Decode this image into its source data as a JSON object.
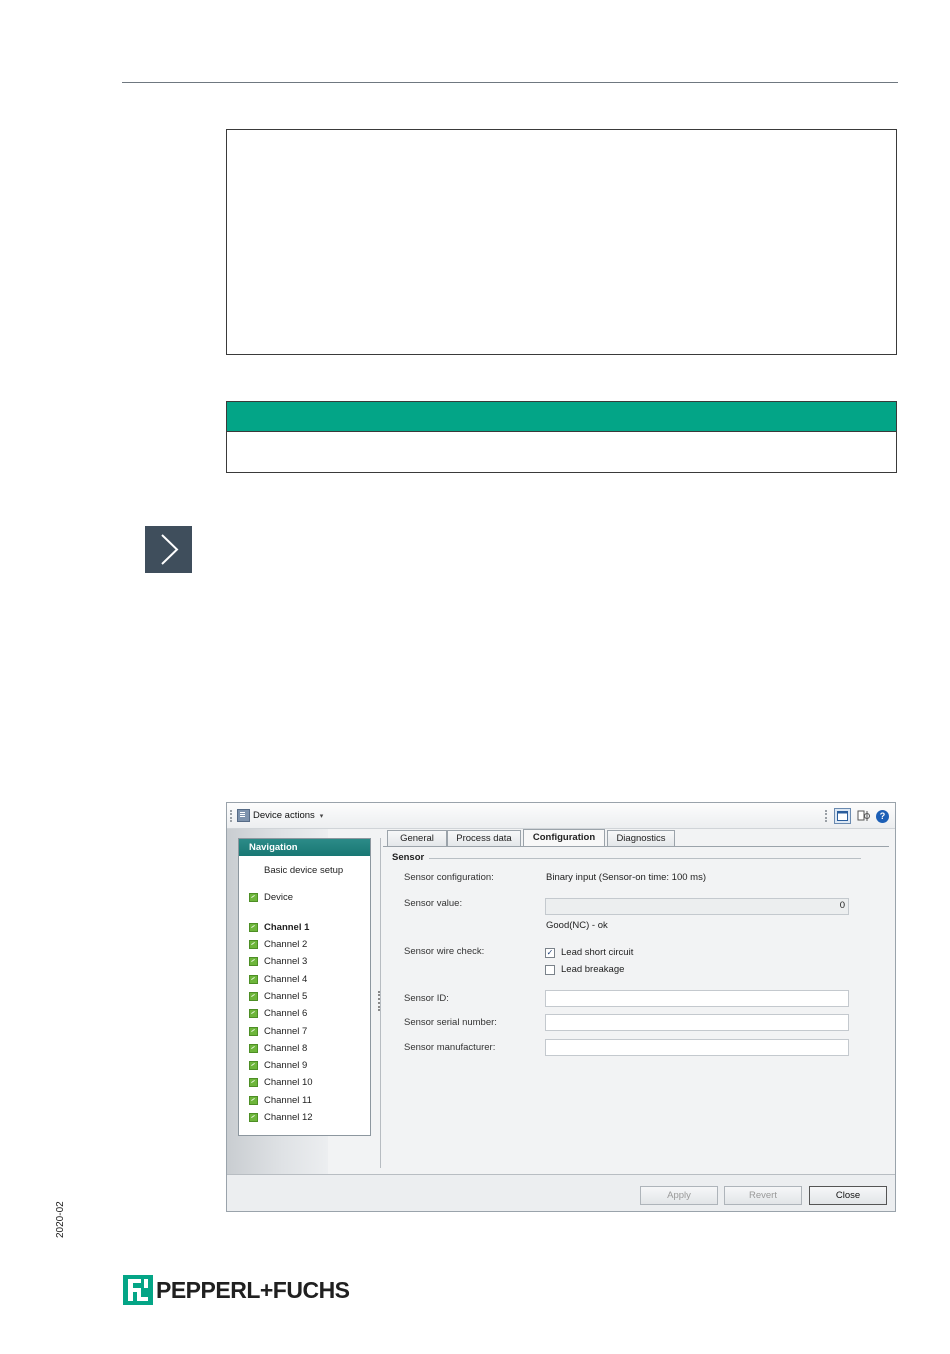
{
  "window": {
    "toolbar": {
      "device_actions_label": "Device actions",
      "caret": "▾"
    },
    "navigation": {
      "title": "Navigation",
      "items": [
        {
          "label": "Basic device setup",
          "status": "none",
          "bold": false
        },
        {
          "label": "Device",
          "status": "ok",
          "bold": false
        },
        {
          "label": "Channel 1",
          "status": "ok",
          "bold": true
        },
        {
          "label": "Channel 2",
          "status": "ok",
          "bold": false
        },
        {
          "label": "Channel 3",
          "status": "ok",
          "bold": false
        },
        {
          "label": "Channel 4",
          "status": "ok",
          "bold": false
        },
        {
          "label": "Channel 5",
          "status": "ok",
          "bold": false
        },
        {
          "label": "Channel 6",
          "status": "ok",
          "bold": false
        },
        {
          "label": "Channel 7",
          "status": "ok",
          "bold": false
        },
        {
          "label": "Channel 8",
          "status": "ok",
          "bold": false
        },
        {
          "label": "Channel 9",
          "status": "ok",
          "bold": false
        },
        {
          "label": "Channel 10",
          "status": "ok",
          "bold": false
        },
        {
          "label": "Channel 11",
          "status": "ok",
          "bold": false
        },
        {
          "label": "Channel 12",
          "status": "ok",
          "bold": false
        }
      ]
    },
    "tabs": [
      {
        "label": "General",
        "active": false
      },
      {
        "label": "Process data",
        "active": false
      },
      {
        "label": "Configuration",
        "active": true
      },
      {
        "label": "Diagnostics",
        "active": false
      }
    ],
    "sensor": {
      "group_title": "Sensor",
      "configuration_label": "Sensor configuration:",
      "configuration_value": "Binary input (Sensor-on time: 100 ms)",
      "value_label": "Sensor value:",
      "value": "0",
      "value_status": "Good(NC) - ok",
      "wire_check_label": "Sensor wire check:",
      "lead_short_circuit_label": "Lead short circuit",
      "lead_short_circuit_checked": true,
      "lead_breakage_label": "Lead breakage",
      "lead_breakage_checked": false,
      "id_label": "Sensor ID:",
      "id_value": "",
      "serial_label": "Sensor serial number:",
      "serial_value": "",
      "manufacturer_label": "Sensor manufacturer:",
      "manufacturer_value": ""
    },
    "buttons": {
      "apply": "Apply",
      "revert": "Revert",
      "close": "Close"
    }
  },
  "page": {
    "side_date": "2020-02",
    "logo_text": "PEPPERL+FUCHS",
    "accent_color": "#03a587",
    "arrow_button_color": "#3f4e5c"
  }
}
